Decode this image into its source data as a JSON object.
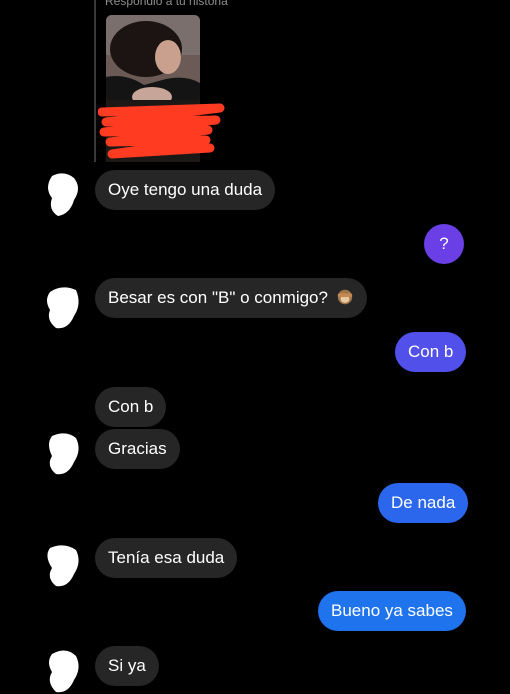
{
  "story_reply": {
    "caption": "Respondió a tu historia"
  },
  "messages": [
    {
      "id": "m1",
      "side": "in",
      "text": "Oye tengo una duda"
    },
    {
      "id": "m2",
      "side": "out",
      "text": "?"
    },
    {
      "id": "m3",
      "side": "in",
      "text": "Besar es con \"B\" o conmigo?",
      "emoji": "see-no-evil-monkey-emoji"
    },
    {
      "id": "m4",
      "side": "out",
      "text": "Con b"
    },
    {
      "id": "m5",
      "side": "in",
      "text": "Con b"
    },
    {
      "id": "m6",
      "side": "in",
      "text": "Gracias"
    },
    {
      "id": "m7",
      "side": "out",
      "text": "De nada"
    },
    {
      "id": "m8",
      "side": "in",
      "text": "Tenía esa duda"
    },
    {
      "id": "m9",
      "side": "out",
      "text": "Bueno ya sabes"
    },
    {
      "id": "m10",
      "side": "in",
      "text": "Si ya"
    }
  ],
  "colors": {
    "background": "#000000",
    "incoming_bubble": "#262626",
    "outgoing_top": "#6a3fe6",
    "outgoing_mid": "#4a55ea",
    "outgoing_bottom": "#1f74ee",
    "redaction": "#ff3b21"
  }
}
